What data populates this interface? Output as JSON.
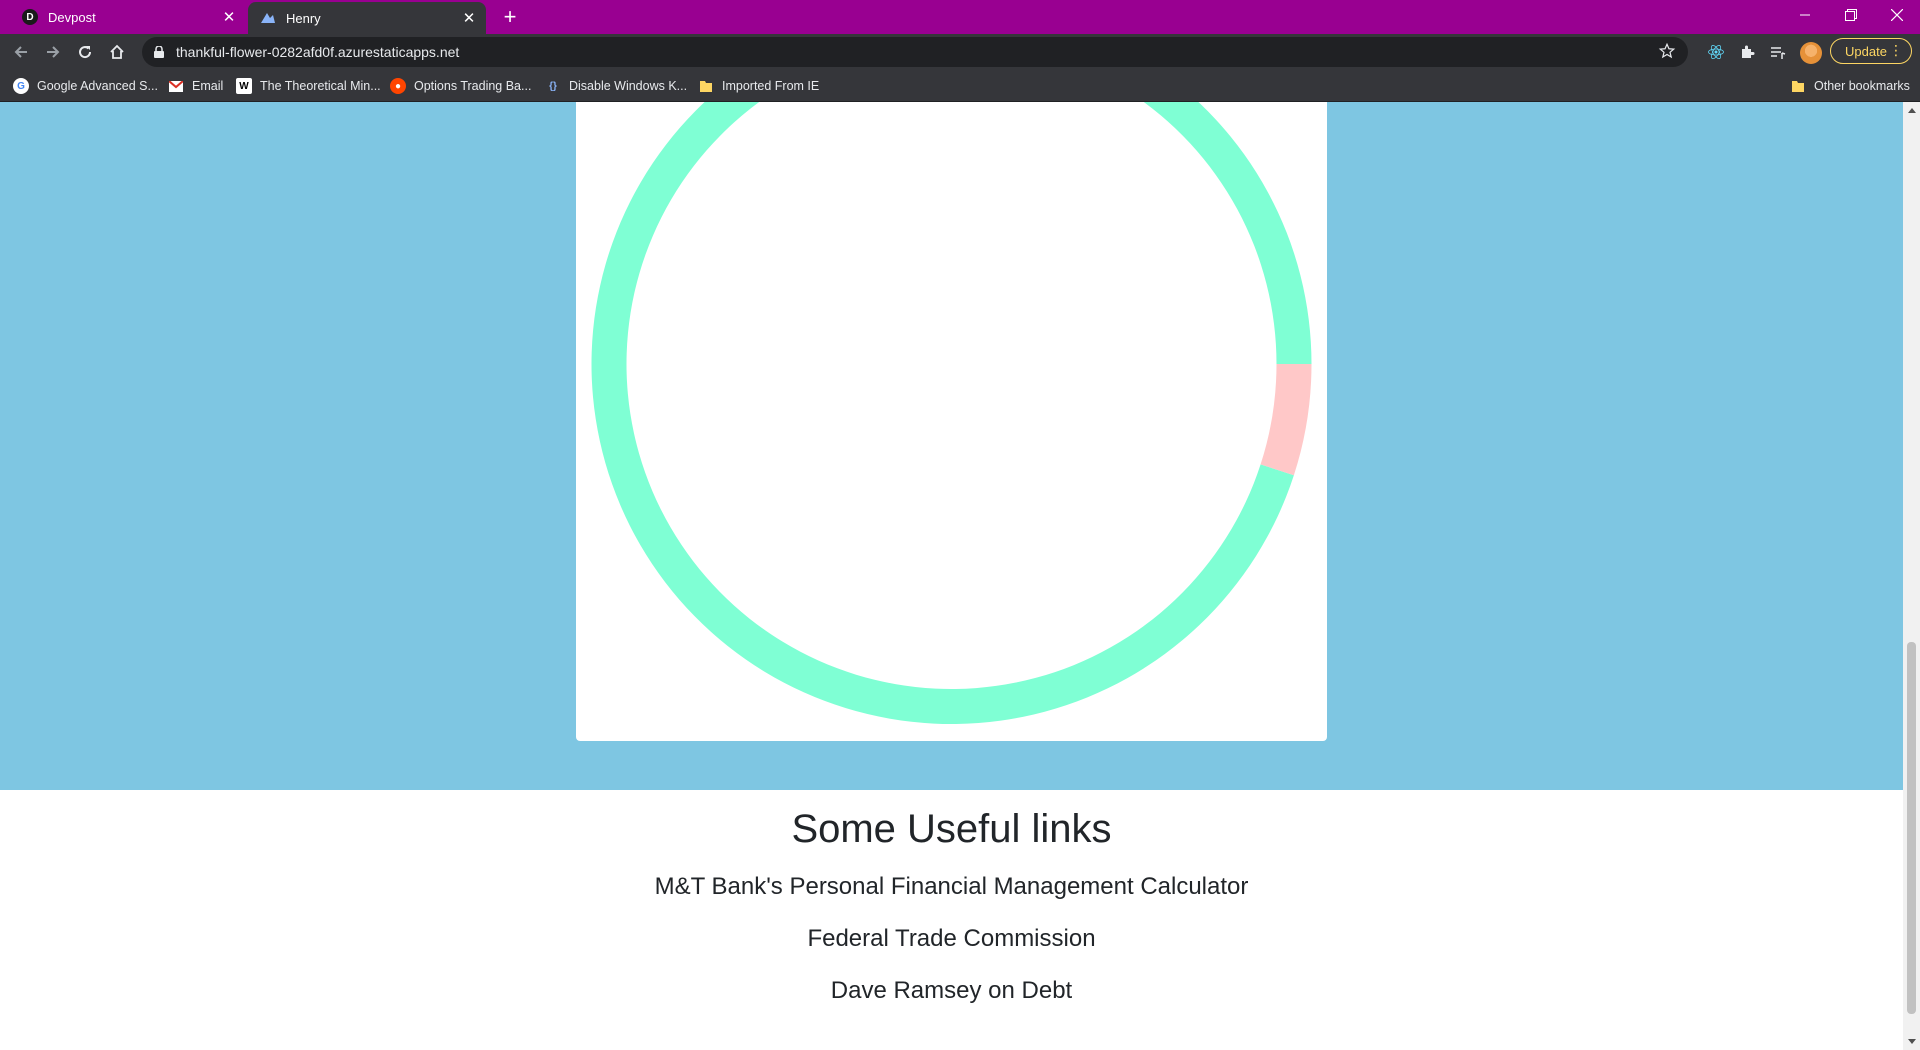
{
  "browser": {
    "tabs": [
      {
        "title": "Devpost",
        "favicon_letter": "D",
        "active": false
      },
      {
        "title": "Henry",
        "active": true
      }
    ],
    "url": "thankful-flower-0282afd0f.azurestaticapps.net",
    "update_label": "Update",
    "bookmarks": [
      {
        "label": "Google Advanced S...",
        "icon": "google-icon"
      },
      {
        "label": "Email",
        "icon": "gmail-icon"
      },
      {
        "label": "The Theoretical Min...",
        "icon": "wikipedia-icon"
      },
      {
        "label": "Options Trading Ba...",
        "icon": "reddit-icon"
      },
      {
        "label": "Disable Windows K...",
        "icon": "code-icon"
      },
      {
        "label": "Imported From IE",
        "icon": "folder-icon"
      }
    ],
    "other_bookmarks": "Other bookmarks"
  },
  "chart_data": {
    "type": "pie",
    "style": "donut",
    "slices": [
      {
        "value": 95,
        "color": "#7fffd4"
      },
      {
        "value": 5,
        "color": "#ffc8c8"
      }
    ],
    "title": "",
    "note": ""
  },
  "links": {
    "heading": "Some Useful links",
    "items": [
      "M&T Bank's Personal Financial Management Calculator",
      "Federal Trade Commission",
      "Dave Ramsey on Debt"
    ]
  },
  "colors": {
    "tab_strip": "#990091",
    "page_background": "#7ec6e2",
    "donut_main": "#7fffd4",
    "donut_secondary": "#ffc8c8"
  }
}
